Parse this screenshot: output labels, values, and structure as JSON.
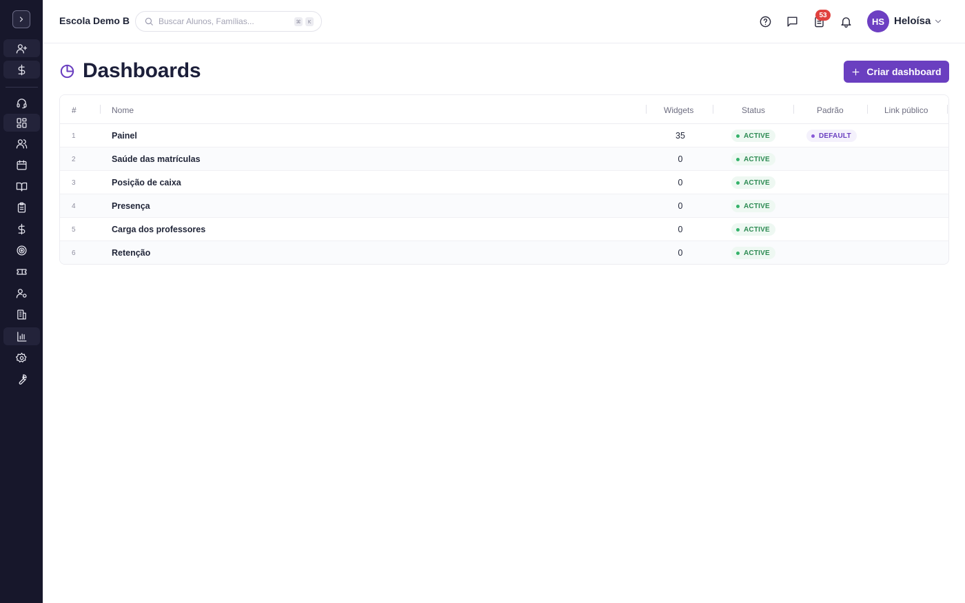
{
  "header": {
    "school_name": "Escola Demo B",
    "search_placeholder": "Buscar Alunos, Famílias...",
    "shortcut_keys": [
      "⌘",
      "K"
    ],
    "notification_count": "53",
    "user_initials": "HS",
    "user_name": "Heloísa"
  },
  "sidebar": {
    "items": [
      {
        "icon": "user-plus-icon"
      },
      {
        "icon": "dollar-icon"
      },
      {
        "icon": "headset-icon"
      },
      {
        "icon": "dashboard-grid-icon"
      },
      {
        "icon": "users-icon"
      },
      {
        "icon": "calendar-icon"
      },
      {
        "icon": "book-open-icon"
      },
      {
        "icon": "clipboard-icon"
      },
      {
        "icon": "dollar-icon"
      },
      {
        "icon": "target-icon"
      },
      {
        "icon": "ticket-icon"
      },
      {
        "icon": "user-settings-icon"
      },
      {
        "icon": "building-icon"
      },
      {
        "icon": "bar-chart-icon"
      },
      {
        "icon": "gear-icon"
      },
      {
        "icon": "wrench-icon"
      }
    ]
  },
  "page": {
    "title": "Dashboards",
    "create_button": "Criar dashboard"
  },
  "table": {
    "columns": [
      "#",
      "Nome",
      "Widgets",
      "Status",
      "Padrão",
      "Link público"
    ],
    "rows": [
      {
        "index": "1",
        "name": "Painel",
        "widgets": "35",
        "status": "ACTIVE",
        "default": "DEFAULT"
      },
      {
        "index": "2",
        "name": "Saúde das matrículas",
        "widgets": "0",
        "status": "ACTIVE",
        "default": ""
      },
      {
        "index": "3",
        "name": "Posição de caixa",
        "widgets": "0",
        "status": "ACTIVE",
        "default": ""
      },
      {
        "index": "4",
        "name": "Presença",
        "widgets": "0",
        "status": "ACTIVE",
        "default": ""
      },
      {
        "index": "5",
        "name": "Carga dos professores",
        "widgets": "0",
        "status": "ACTIVE",
        "default": ""
      },
      {
        "index": "6",
        "name": "Retenção",
        "widgets": "0",
        "status": "ACTIVE",
        "default": ""
      }
    ]
  },
  "colors": {
    "sidebar_bg": "#17172b",
    "accent": "#6a3fc0",
    "status_green": "#2c8a52",
    "badge_red": "#e0413e"
  }
}
